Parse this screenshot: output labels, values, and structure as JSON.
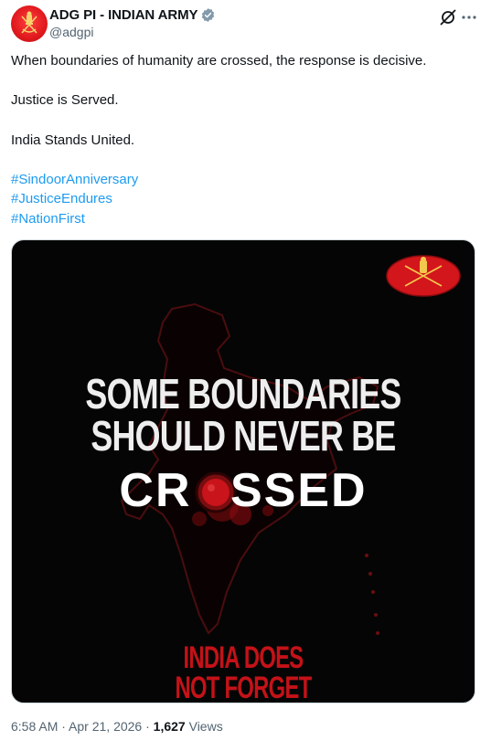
{
  "account": {
    "display_name": "ADG PI - INDIAN ARMY",
    "handle": "@adgpi",
    "verified_icon": "verified-badge-icon",
    "avatar_color": "#e0191d"
  },
  "actions": {
    "grok_icon": "grok-icon",
    "more_icon": "more-icon",
    "more_label": "···"
  },
  "tweet": {
    "line1": "When boundaries of humanity are crossed, the response is decisive.",
    "line2": "Justice is Served.",
    "line3": "India Stands United.",
    "hashtags": [
      "#SindoorAnniversary",
      "#JusticeEndures",
      "#NationFirst"
    ],
    "link_color": "#1d9bf0"
  },
  "media": {
    "headline_line1": "SOME BOUNDARIES",
    "headline_line2": "SHOULD NEVER BE",
    "crossed_prefix": "CR",
    "crossed_o": "O",
    "crossed_suffix": "SSED",
    "footer_line1": "INDIA DOES",
    "footer_line2": "NOT FORGET",
    "accent_color": "#c41218",
    "background_color": "#050505"
  },
  "meta": {
    "time": "6:58 AM",
    "separator": " · ",
    "date": "Apr 21, 2026",
    "views_count": "1,627",
    "views_label": " Views"
  }
}
